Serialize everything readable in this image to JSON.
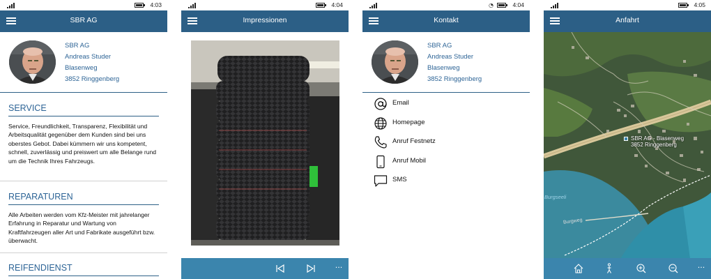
{
  "colors": {
    "titlebar": "#2c5f86",
    "link": "#2d6496",
    "appbar": "#3b85ad"
  },
  "screens": [
    {
      "status": {
        "time": "4:03"
      },
      "title": "SBR AG",
      "address": [
        "SBR AG",
        "Andreas Studer",
        "Blasenweg",
        "3852 Ringgenberg"
      ],
      "sections": [
        {
          "heading": "SERVICE",
          "text": "Service, Freundlichkeit, Transparenz, Flexibilität und Arbeitsqualität gegenüber dem Kunden sind bei uns oberstes Gebot. Dabei kümmern wir uns kompetent, schnell, zuverlässig und preiswert um alle Belange rund um die Technik Ihres Fahrzeugs."
        },
        {
          "heading": "REPARATUREN",
          "text": "Alle Arbeiten werden vom Kfz-Meister mit jahrelanger Erfahrung in Reparatur und Wartung von Kraftfahrzeugen aller Art und Fabrikate ausgeführt bzw. überwacht."
        },
        {
          "heading": "REIFENDIENST",
          "text": ""
        }
      ]
    },
    {
      "status": {
        "time": "4:04"
      },
      "title": "Impressionen",
      "appbar": {
        "prev_icon": "skip-previous-icon",
        "next_icon": "skip-next-icon",
        "more": "···"
      }
    },
    {
      "status": {
        "time": "4:04"
      },
      "title": "Kontakt",
      "address": [
        "SBR AG",
        "Andreas Studer",
        "Blasenweg",
        "3852 Ringgenberg"
      ],
      "contacts": [
        {
          "label": "Email",
          "icon": "at-icon"
        },
        {
          "label": "Homepage",
          "icon": "globe-icon"
        },
        {
          "label": "Anruf Festnetz",
          "icon": "phone-icon"
        },
        {
          "label": "Anruf Mobil",
          "icon": "mobile-phone-icon"
        },
        {
          "label": "SMS",
          "icon": "chat-bubble-icon"
        }
      ]
    },
    {
      "status": {
        "time": "4:05"
      },
      "title": "Anfahrt",
      "map": {
        "pin_label_1": "SBR AG - Blasenweg",
        "pin_label_2": "3852 Ringgenberg",
        "lake_label": "Burgseeli",
        "road_label": "Burgweg"
      },
      "appbar": {
        "more": "···"
      }
    }
  ]
}
